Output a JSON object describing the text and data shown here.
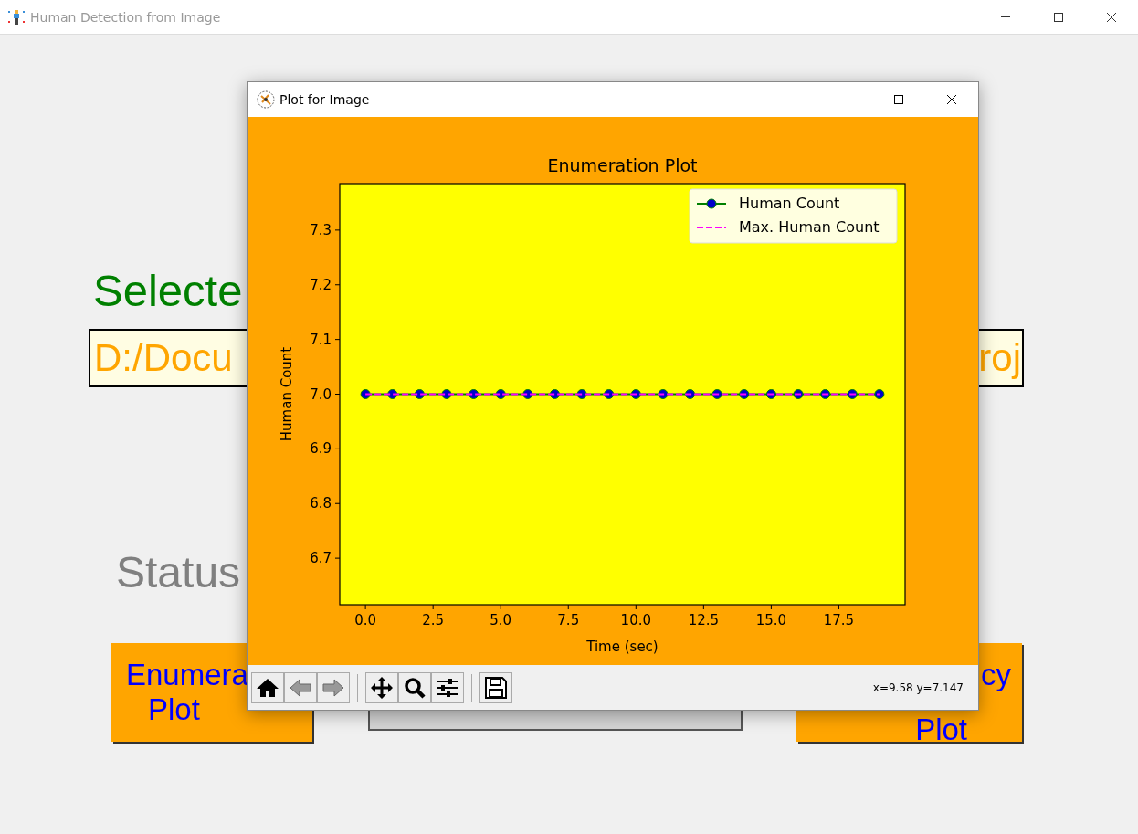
{
  "window": {
    "title": "Human Detection from Image"
  },
  "main": {
    "selected_label": "Selecte",
    "path_field": {
      "value_start": "D:/Docu",
      "value_end": "roj"
    },
    "status_label": "Status",
    "buttons": [
      {
        "kind": "accent",
        "lines": [
          "Enumera",
          "Plot"
        ]
      },
      {
        "kind": "plain"
      },
      {
        "kind": "accent",
        "lines": [
          "cy",
          "Plot"
        ]
      }
    ]
  },
  "plot_window": {
    "title": "Plot for Image",
    "coordinates": "x=9.58 y=7.147",
    "chart_data": {
      "type": "line",
      "title": "Enumeration Plot",
      "xlabel": "Time (sec)",
      "ylabel": "Human Count",
      "x": [
        0,
        1,
        2,
        3,
        4,
        5,
        6,
        7,
        8,
        9,
        10,
        11,
        12,
        13,
        14,
        15,
        16,
        17,
        18,
        19
      ],
      "legend": true,
      "series": [
        {
          "name": "Human Count",
          "color": "#008000",
          "marker": "o",
          "line_style": "-",
          "values": [
            7,
            7,
            7,
            7,
            7,
            7,
            7,
            7,
            7,
            7,
            7,
            7,
            7,
            7,
            7,
            7,
            7,
            7,
            7,
            7
          ]
        },
        {
          "name": "Max. Human Count",
          "color": "#ff00ff",
          "line_style": "--",
          "values": [
            7,
            7,
            7,
            7,
            7,
            7,
            7,
            7,
            7,
            7,
            7,
            7,
            7,
            7,
            7,
            7,
            7,
            7,
            7,
            7
          ]
        }
      ],
      "xlim": [
        -0.95,
        19.95
      ],
      "ylim": [
        6.615,
        7.385
      ],
      "xticks": [
        {
          "value": 0,
          "label": "0.0"
        },
        {
          "value": 2.5,
          "label": "2.5"
        },
        {
          "value": 5,
          "label": "5.0"
        },
        {
          "value": 7.5,
          "label": "7.5"
        },
        {
          "value": 10,
          "label": "10.0"
        },
        {
          "value": 12.5,
          "label": "12.5"
        },
        {
          "value": 15,
          "label": "15.0"
        },
        {
          "value": 17.5,
          "label": "17.5"
        }
      ],
      "yticks": [
        {
          "value": 6.7,
          "label": "6.7"
        },
        {
          "value": 6.8,
          "label": "6.8"
        },
        {
          "value": 6.9,
          "label": "6.9"
        },
        {
          "value": 7,
          "label": "7.0"
        },
        {
          "value": 7.1,
          "label": "7.1"
        },
        {
          "value": 7.2,
          "label": "7.2"
        },
        {
          "value": 7.3,
          "label": "7.3"
        }
      ]
    }
  }
}
